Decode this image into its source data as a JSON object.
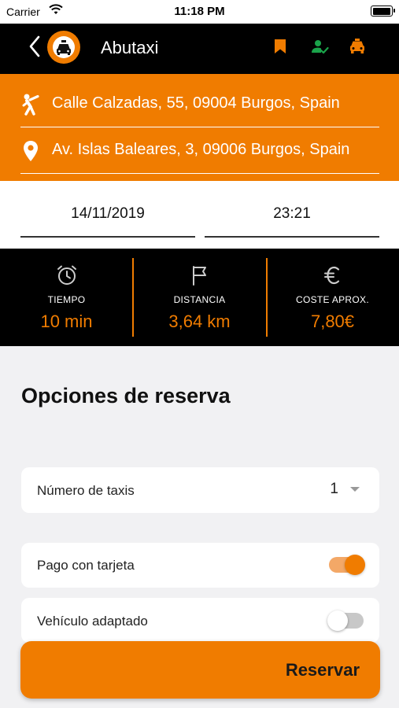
{
  "status_bar": {
    "carrier": "Carrier",
    "time": "11:18 PM"
  },
  "header": {
    "title": "Abutaxi",
    "icons": [
      "back-chevron-icon",
      "taxi-logo-icon",
      "bookmark-icon",
      "user-check-icon",
      "taxi-icon"
    ]
  },
  "route": {
    "origin": "Calle Calzadas, 55, 09004 Burgos, Spain",
    "destination": "Av. Islas Baleares, 3, 09006 Burgos, Spain"
  },
  "schedule": {
    "date": "14/11/2019",
    "time": "23:21"
  },
  "stats": [
    {
      "icon": "alarm-clock-icon",
      "label": "TIEMPO",
      "value": "10 min"
    },
    {
      "icon": "flag-icon",
      "label": "DISTANCIA",
      "value": "3,64 km"
    },
    {
      "icon": "euro-icon",
      "label": "COSTE APROX.",
      "value": "7,80€"
    }
  ],
  "options": {
    "title": "Opciones de reserva",
    "taxi_count_label": "Número de taxis",
    "taxi_count_value": "1",
    "card_payment_label": "Pago con tarjeta",
    "card_payment_on": true,
    "adapted_vehicle_label": "Vehículo adaptado",
    "adapted_vehicle_on": false
  },
  "reserve_button": "Reservar",
  "colors": {
    "accent": "#f07c00",
    "success": "#1aa34a",
    "bar": "#000000"
  }
}
